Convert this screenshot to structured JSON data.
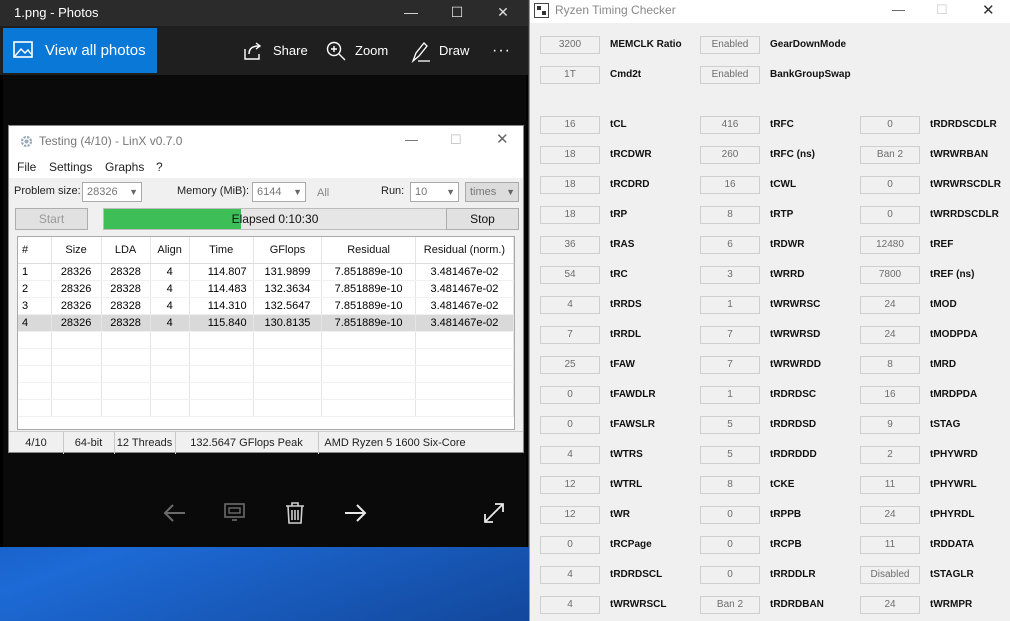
{
  "photos": {
    "title": "1.png - Photos",
    "view_all_label": "View all photos",
    "share_label": "Share",
    "zoom_label": "Zoom",
    "draw_label": "Draw",
    "more_label": "···",
    "accent_color": "#0a78d7"
  },
  "linx": {
    "title": "Testing (4/10) - LinX v0.7.0",
    "menu": [
      "File",
      "Settings",
      "Graphs",
      "?"
    ],
    "problem_size_label": "Problem size:",
    "problem_size_value": "28326",
    "memory_label": "Memory (MiB):",
    "memory_value": "6144",
    "all_label": "All",
    "run_label": "Run:",
    "run_value": "10",
    "times_value": "times",
    "start_label": "Start",
    "stop_label": "Stop",
    "progress_fraction": 0.4,
    "elapsed_text": "Elapsed 0:10:30",
    "columns": [
      "#",
      "Size",
      "LDA",
      "Align",
      "Time",
      "GFlops",
      "Residual",
      "Residual (norm.)"
    ],
    "rows": [
      [
        "1",
        "28326",
        "28328",
        "4",
        "114.807",
        "131.9899",
        "7.851889e-10",
        "3.481467e-02"
      ],
      [
        "2",
        "28326",
        "28328",
        "4",
        "114.483",
        "132.3634",
        "7.851889e-10",
        "3.481467e-02"
      ],
      [
        "3",
        "28326",
        "28328",
        "4",
        "114.310",
        "132.5647",
        "7.851889e-10",
        "3.481467e-02"
      ],
      [
        "4",
        "28326",
        "28328",
        "4",
        "115.840",
        "130.8135",
        "7.851889e-10",
        "3.481467e-02"
      ]
    ],
    "status": {
      "progress": "4/10",
      "bits": "64-bit",
      "threads": "12 Threads",
      "peak": "132.5647 GFlops Peak",
      "cpu": "AMD Ryzen 5 1600 Six-Core"
    }
  },
  "rtc": {
    "title": "Ryzen Timing Checker",
    "top_rows": [
      [
        {
          "value": "3200",
          "label": "MEMCLK Ratio"
        },
        {
          "value": "Enabled",
          "label": "GearDownMode"
        }
      ],
      [
        {
          "value": "1T",
          "label": "Cmd2t"
        },
        {
          "value": "Enabled",
          "label": "BankGroupSwap"
        }
      ]
    ],
    "timings": [
      [
        {
          "value": "16",
          "label": "tCL"
        },
        {
          "value": "416",
          "label": "tRFC"
        },
        {
          "value": "0",
          "label": "tRDRDSCDLR"
        }
      ],
      [
        {
          "value": "18",
          "label": "tRCDWR"
        },
        {
          "value": "260",
          "label": "tRFC (ns)"
        },
        {
          "value": "Ban 2",
          "label": "tWRWRBAN"
        }
      ],
      [
        {
          "value": "18",
          "label": "tRCDRD"
        },
        {
          "value": "16",
          "label": "tCWL"
        },
        {
          "value": "0",
          "label": "tWRWRSCDLR"
        }
      ],
      [
        {
          "value": "18",
          "label": "tRP"
        },
        {
          "value": "8",
          "label": "tRTP"
        },
        {
          "value": "0",
          "label": "tWRRDSCDLR"
        }
      ],
      [
        {
          "value": "36",
          "label": "tRAS"
        },
        {
          "value": "6",
          "label": "tRDWR"
        },
        {
          "value": "12480",
          "label": "tREF"
        }
      ],
      [
        {
          "value": "54",
          "label": "tRC"
        },
        {
          "value": "3",
          "label": "tWRRD"
        },
        {
          "value": "7800",
          "label": "tREF (ns)"
        }
      ],
      [
        {
          "value": "4",
          "label": "tRRDS"
        },
        {
          "value": "1",
          "label": "tWRWRSC"
        },
        {
          "value": "24",
          "label": "tMOD"
        }
      ],
      [
        {
          "value": "7",
          "label": "tRRDL"
        },
        {
          "value": "7",
          "label": "tWRWRSD"
        },
        {
          "value": "24",
          "label": "tMODPDA"
        }
      ],
      [
        {
          "value": "25",
          "label": "tFAW"
        },
        {
          "value": "7",
          "label": "tWRWRDD"
        },
        {
          "value": "8",
          "label": "tMRD"
        }
      ],
      [
        {
          "value": "0",
          "label": "tFAWDLR"
        },
        {
          "value": "1",
          "label": "tRDRDSC"
        },
        {
          "value": "16",
          "label": "tMRDPDA"
        }
      ],
      [
        {
          "value": "0",
          "label": "tFAWSLR"
        },
        {
          "value": "5",
          "label": "tRDRDSD"
        },
        {
          "value": "9",
          "label": "tSTAG"
        }
      ],
      [
        {
          "value": "4",
          "label": "tWTRS"
        },
        {
          "value": "5",
          "label": "tRDRDDD"
        },
        {
          "value": "2",
          "label": "tPHYWRD"
        }
      ],
      [
        {
          "value": "12",
          "label": "tWTRL"
        },
        {
          "value": "8",
          "label": "tCKE"
        },
        {
          "value": "11",
          "label": "tPHYWRL"
        }
      ],
      [
        {
          "value": "12",
          "label": "tWR"
        },
        {
          "value": "0",
          "label": "tRPPB"
        },
        {
          "value": "24",
          "label": "tPHYRDL"
        }
      ],
      [
        {
          "value": "0",
          "label": "tRCPage"
        },
        {
          "value": "0",
          "label": "tRCPB"
        },
        {
          "value": "11",
          "label": "tRDDATA"
        }
      ],
      [
        {
          "value": "4",
          "label": "tRDRDSCL"
        },
        {
          "value": "0",
          "label": "tRRDDLR"
        },
        {
          "value": "Disabled",
          "label": "tSTAGLR"
        }
      ],
      [
        {
          "value": "4",
          "label": "tWRWRSCL"
        },
        {
          "value": "Ban 2",
          "label": "tRDRDBAN"
        },
        {
          "value": "24",
          "label": "tWRMPR"
        }
      ]
    ]
  }
}
